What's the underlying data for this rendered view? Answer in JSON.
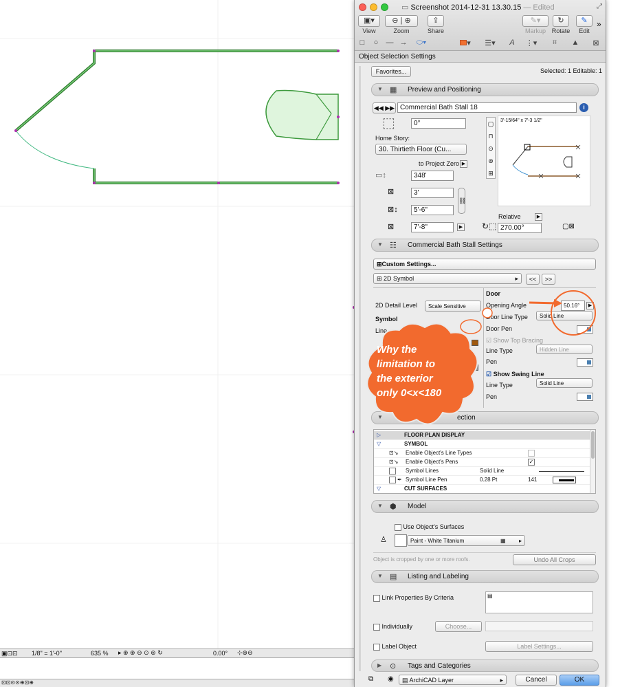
{
  "window": {
    "title": "Screenshot 2014-12-31 13.30.15",
    "edited": "— Edited",
    "toolbar": {
      "view": "View",
      "zoom": "Zoom",
      "share": "Share",
      "markup": "Markup",
      "rotate": "Rotate",
      "edit": "Edit"
    }
  },
  "dialog": {
    "title": "Object Selection Settings",
    "favorites": "Favorites...",
    "selected_info": "Selected: 1 Editable: 1",
    "preview": {
      "header": "Preview and Positioning",
      "object_name": "Commercial Bath Stall 18",
      "angle": "0°",
      "home_story_label": "Home Story:",
      "home_story_value": "30. Thirtieth Floor (Cu...",
      "to_project_zero": "to Project Zero",
      "elevation": "348'",
      "width": "3'",
      "depth": "5'-6\"",
      "height": "7'-8\"",
      "preview_size": "3'-15/64\" x 7'-3 1/2\"",
      "relative_label": "Relative",
      "rotation": "270.00°"
    },
    "stall_settings": {
      "header": "Commercial Bath Stall Settings",
      "custom_settings": "Custom Settings...",
      "page_selector": "2D Symbol",
      "prev_btn": "<<",
      "next_btn": ">>",
      "detail_level_label": "2D Detail Level",
      "detail_level_value": "Scale Sensitive",
      "symbol_label": "Symbol",
      "line_label": "Line",
      "door_label": "Door",
      "opening_angle_label": "Opening Angle",
      "opening_angle_value": "50.16°",
      "door_line_type_label": "Door Line Type",
      "door_line_type_value": "Solid Line",
      "door_pen_label": "Door Pen",
      "show_top_bracing": "Show Top Bracing",
      "bracing_line_type_label": "Line Type",
      "bracing_line_type_value": "Hidden Line",
      "bracing_pen_label": "Pen",
      "show_swing_line": "Show Swing Line",
      "swing_line_type_label": "Line Type",
      "swing_line_type_value": "Solid Line",
      "swing_pen_label": "Pen",
      "section_label": "ection"
    },
    "table": {
      "rows": [
        {
          "name": "FLOOR PLAN DISPLAY",
          "value": "",
          "extra": ""
        },
        {
          "name": "SYMBOL",
          "value": "",
          "extra": ""
        },
        {
          "name": "Enable Object's Line Types",
          "value": "",
          "extra": ""
        },
        {
          "name": "Enable Object's Pens",
          "value": "",
          "extra": ""
        },
        {
          "name": "Symbol Lines",
          "value": "Solid Line",
          "extra": ""
        },
        {
          "name": "Symbol Line Pen",
          "value": "0.28 Pt",
          "extra": "141"
        },
        {
          "name": "CUT SURFACES",
          "value": "",
          "extra": ""
        }
      ]
    },
    "model": {
      "header": "Model",
      "use_surfaces": "Use Object's Surfaces",
      "surface": "Paint - White Titanium",
      "crop_note": "Object is cropped by one or more roofs.",
      "undo_crops": "Undo All Crops"
    },
    "listing": {
      "header": "Listing and Labeling",
      "link_properties": "Link Properties By Criteria",
      "individually": "Individually",
      "choose": "Choose...",
      "label_object": "Label Object",
      "label_settings": "Label Settings..."
    },
    "tags": {
      "header": "Tags and Categories"
    },
    "footer": {
      "layer": "ArchiCAD Layer",
      "cancel": "Cancel",
      "ok": "OK"
    }
  },
  "annotation": {
    "line1": "Why the",
    "line2": "limitation to",
    "line3": "the exterior",
    "line4": "only 0<x<180",
    "color": "#f26a2e"
  },
  "status_bar": {
    "scale": "1/8\"  =  1'-0\"",
    "zoom": "635 %",
    "angle": "0.00°"
  }
}
